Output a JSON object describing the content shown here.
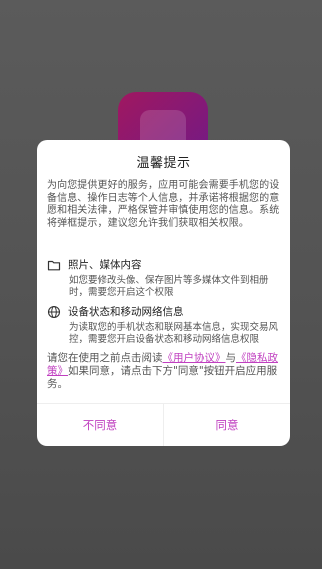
{
  "dialog": {
    "title": "温馨提示",
    "intro": "为向您提供更好的服务，应用可能会需要手机您的设备信息、操作日志等个人信息，并承诺将根据您的意愿和相关法律，严格保管并审慎使用您的信息。系统将弹框提示，建议您允许我们获取相关权限。",
    "permissions": [
      {
        "icon": "folder-icon",
        "title": "照片、媒体内容",
        "desc": "如您要修改头像、保存图片等多媒体文件到相册时，需要您开启这个权限"
      },
      {
        "icon": "globe-icon",
        "title": "设备状态和移动网络信息",
        "desc": "为读取您的手机状态和联网基本信息，实现交易风控，需要您开启设备状态和移动网络信息权限"
      }
    ],
    "notice": {
      "prefix": "请您在使用之前点击阅读",
      "agreement_link": "《用户协议》",
      "and": "与",
      "privacy_link": "《隐私政策》",
      "suffix": "如果同意，请点击下方\"同意\"按钮开启应用服务。"
    },
    "buttons": {
      "disagree": "不同意",
      "agree": "同意"
    }
  },
  "colors": {
    "accent": "#c040c0",
    "icon_gradient_start": "#a01860",
    "icon_gradient_end": "#6c1a8a"
  }
}
